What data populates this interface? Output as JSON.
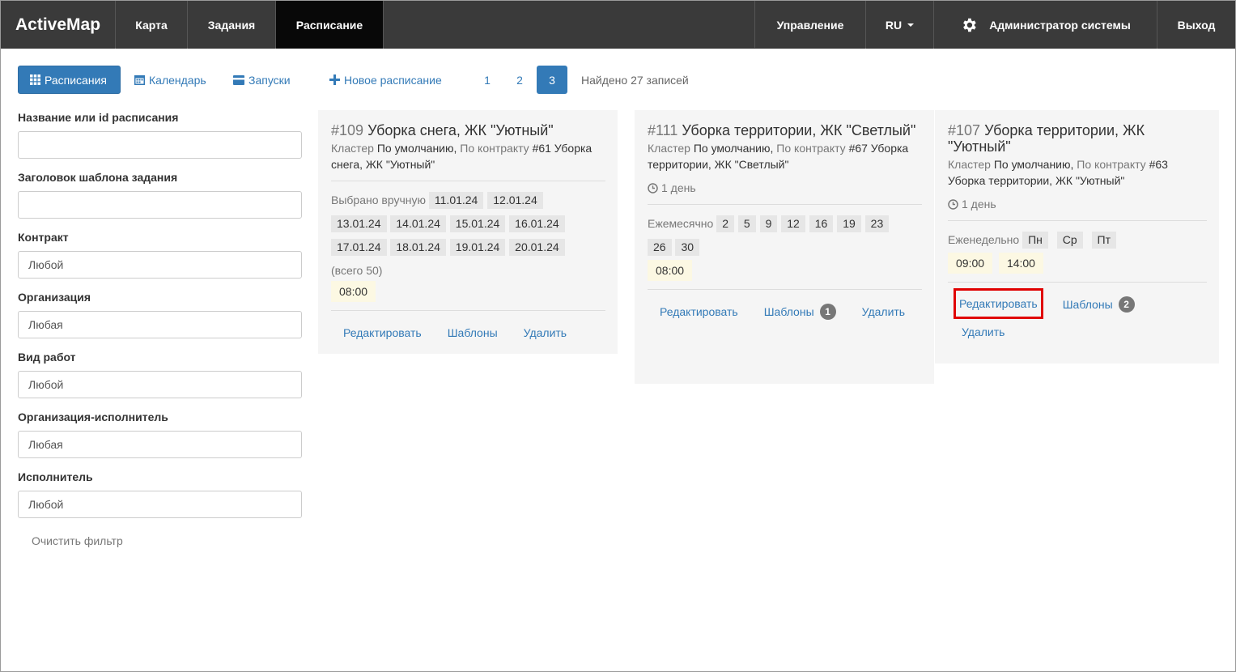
{
  "navbar": {
    "brand": "ActiveMap",
    "items": [
      "Карта",
      "Задания",
      "Расписание"
    ],
    "right": {
      "manage": "Управление",
      "lang": "RU",
      "user": "Администратор системы",
      "logout": "Выход"
    }
  },
  "toolbar": {
    "schedules": "Расписания",
    "calendar": "Календарь",
    "launches": "Запуски",
    "new_schedule": "Новое расписание",
    "pages": [
      "1",
      "2",
      "3"
    ],
    "active_page": "3",
    "found": "Найдено 27 записей"
  },
  "filters": {
    "name_label": "Название или id расписания",
    "name_value": "",
    "template_label": "Заголовок шаблона задания",
    "template_value": "",
    "contract_label": "Контракт",
    "contract_value": "Любой",
    "org_label": "Организация",
    "org_value": "Любая",
    "worktype_label": "Вид работ",
    "worktype_value": "Любой",
    "executor_org_label": "Организация-исполнитель",
    "executor_org_value": "Любая",
    "executor_label": "Исполнитель",
    "executor_value": "Любой",
    "clear": "Очистить фильтр"
  },
  "cards": [
    {
      "id": "#109",
      "title": "Уборка снега, ЖК \"Уютный\"",
      "cluster_label": "Кластер",
      "cluster": "По умолчанию,",
      "contract_label": "По контракту",
      "contract": "#61 Уборка снега, ЖК \"Уютный\"",
      "mode": "Выбрано вручную",
      "dates": [
        "11.01.24",
        "12.01.24",
        "13.01.24",
        "14.01.24",
        "15.01.24",
        "16.01.24",
        "17.01.24",
        "18.01.24",
        "19.01.24",
        "20.01.24"
      ],
      "total": "(всего 50)",
      "times": [
        "08:00"
      ],
      "edit": "Редактировать",
      "templates": "Шаблоны",
      "delete": "Удалить"
    },
    {
      "id": "#111",
      "title": "Уборка территории, ЖК \"Светлый\"",
      "cluster_label": "Кластер",
      "cluster": "По умолчанию,",
      "contract_label": "По контракту",
      "contract": "#67 Уборка территории, ЖК \"Светлый\"",
      "duration": "1 день",
      "mode": "Ежемесячно",
      "days": [
        "2",
        "5",
        "9",
        "12",
        "16",
        "19",
        "23",
        "26",
        "30"
      ],
      "times": [
        "08:00"
      ],
      "edit": "Редактировать",
      "templates": "Шаблоны",
      "templates_count": "1",
      "delete": "Удалить"
    },
    {
      "id": "#107",
      "title": "Уборка территории, ЖК \"Уютный\"",
      "cluster_label": "Кластер",
      "cluster": "По умолчанию,",
      "contract_label": "По контракту",
      "contract": "#63 Уборка территории, ЖК \"Уютный\"",
      "duration": "1 день",
      "mode": "Еженедельно",
      "days": [
        "Пн",
        "Ср",
        "Пт"
      ],
      "times": [
        "09:00",
        "14:00"
      ],
      "edit": "Редактировать",
      "templates": "Шаблоны",
      "templates_count": "2",
      "delete": "Удалить"
    }
  ]
}
